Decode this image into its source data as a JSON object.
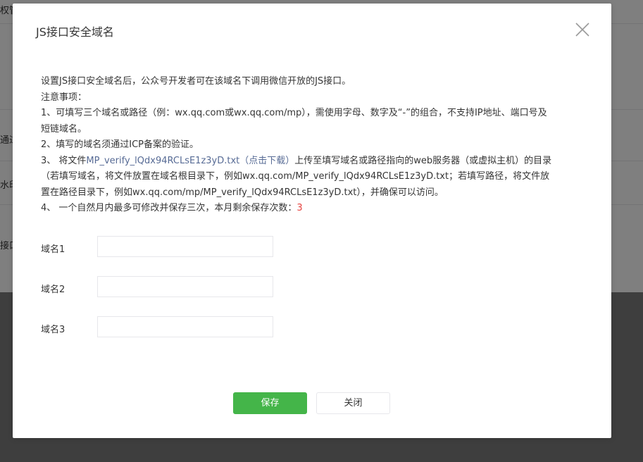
{
  "background": {
    "fragments": [
      "权管",
      "通过",
      "水印",
      "接口"
    ]
  },
  "dialog": {
    "title": "JS接口安全域名",
    "close_icon": "close-icon",
    "notes": {
      "intro": "设置JS接口安全域名后，公众号开发者可在该域名下调用微信开放的JS接口。",
      "heading": "注意事项：",
      "item1_line1": "1、可填写三个域名或路径（例：wx.qq.com或wx.qq.com/mp），需使用字母、数字及“-”的组合，不支持IP地址、端口号及",
      "item1_line2": "短链域名。",
      "item2": "2、填写的域名须通过ICP备案的验证。",
      "item3_prefix": "3、 将文件",
      "item3_file_link": "MP_verify_lQdx94RCLsE1z3yD.txt",
      "item3_download_link": "（点击下载）",
      "item3_suffix": "上传至填写域名或路径指向的web服务器（或虚拟主机）的目录",
      "item3_line2": "（若填写域名，将文件放置在域名根目录下，例如wx.qq.com/MP_verify_lQdx94RCLsE1z3yD.txt；若填写路径，将文件放",
      "item3_line3": "置在路径目录下，例如wx.qq.com/mp/MP_verify_lQdx94RCLsE1z3yD.txt），并确保可以访问。",
      "item4_prefix": "4、 一个自然月内最多可修改并保存三次，本月剩余保存次数：",
      "item4_count": "3"
    },
    "fields": [
      {
        "label": "域名1",
        "value": ""
      },
      {
        "label": "域名2",
        "value": ""
      },
      {
        "label": "域名3",
        "value": ""
      }
    ],
    "buttons": {
      "save": "保存",
      "close": "关闭"
    }
  },
  "colors": {
    "primary": "#44b549",
    "link": "#576b95",
    "count": "#e64340"
  }
}
